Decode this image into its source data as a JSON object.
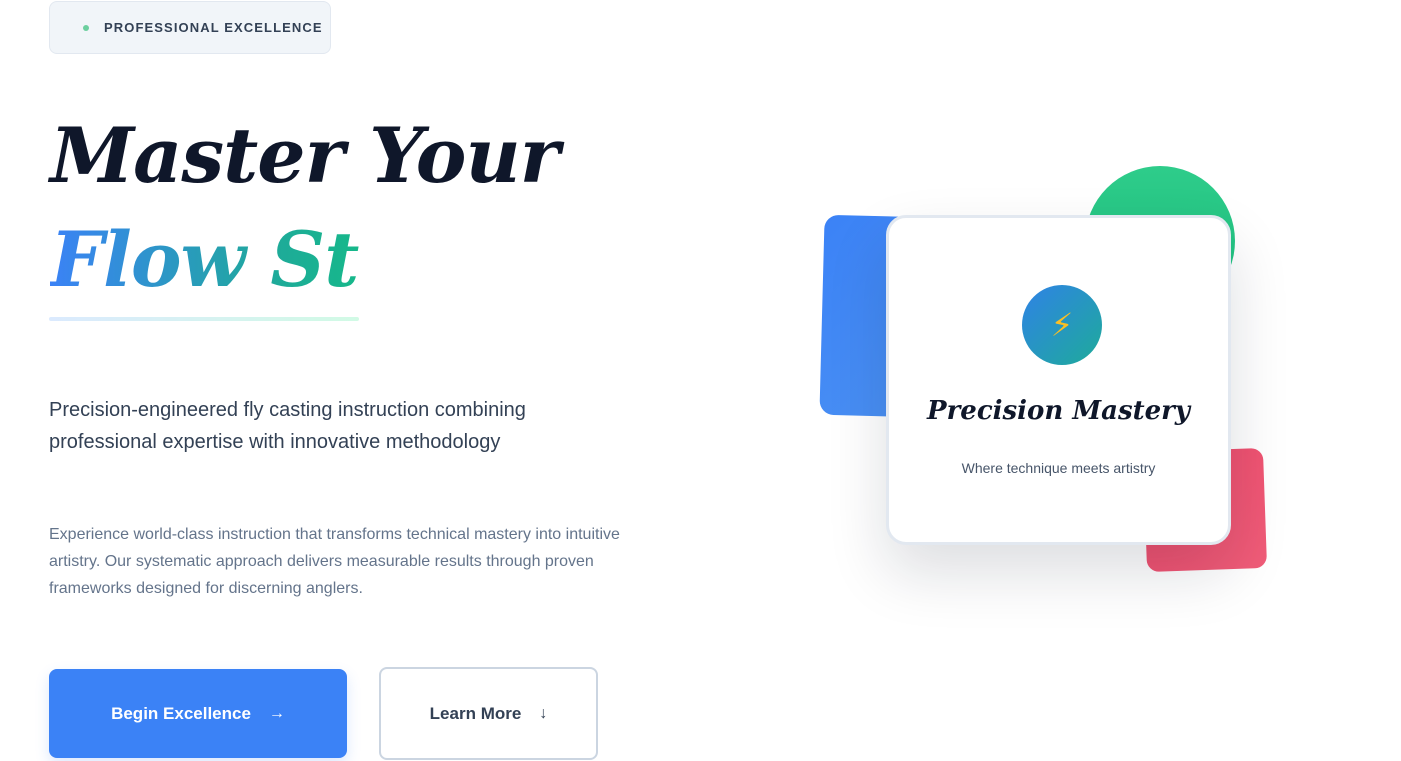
{
  "badge": {
    "label": "PROFESSIONAL EXCELLENCE"
  },
  "hero": {
    "headline_line1": "Master Your",
    "headline_line2": "Flow State",
    "lead": "Precision-engineered fly casting instruction combining professional expertise with innovative methodology",
    "body": "Experience world-class instruction that transforms technical mastery into intuitive artistry. Our systematic approach delivers measurable results through proven frameworks designed for discerning anglers."
  },
  "actions": {
    "primary_label": "Begin Excellence",
    "primary_icon": "→",
    "secondary_label": "Learn More",
    "secondary_icon": "↓"
  },
  "card": {
    "icon": "⚡",
    "title": "Precision Mastery",
    "subtitle": "Where technique meets artistry"
  },
  "colors": {
    "primary": "#3b82f6",
    "teal": "#1eab9a",
    "green": "#2ecc8a",
    "red": "#ef4a6b",
    "text_dark": "#0f172a"
  }
}
